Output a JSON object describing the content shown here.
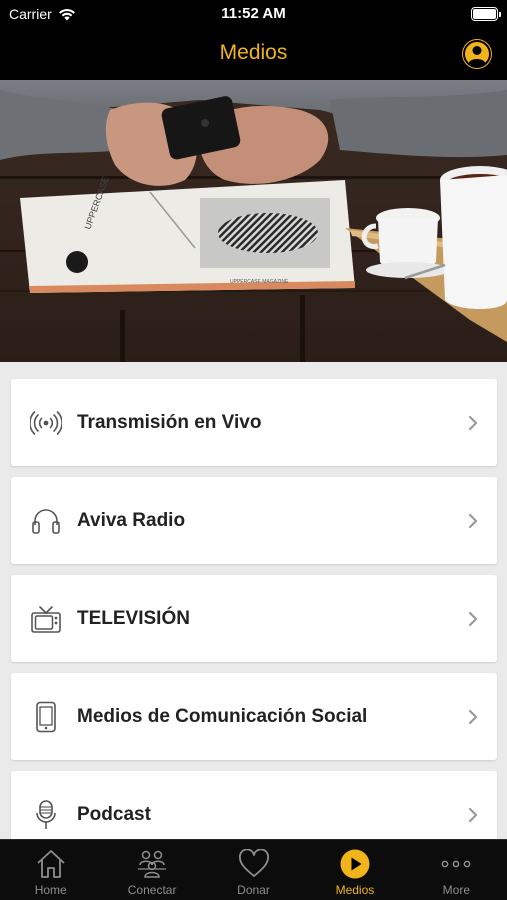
{
  "status_bar": {
    "carrier": "Carrier",
    "time": "11:52 AM",
    "battery_level": 1.0
  },
  "nav": {
    "title": "Medios",
    "profile_icon": "user-circle-icon"
  },
  "colors": {
    "accent": "#f2b41c",
    "background": "#000000",
    "list_background": "#eaeaea",
    "card": "#ffffff",
    "text": "#222222",
    "inactive": "#8e8e8e"
  },
  "hero": {
    "magazine_text": "UPPERCASE",
    "magazine_footer": "UPPERCASE MAGAZINE"
  },
  "menu": [
    {
      "label": "Transmisión en Vivo",
      "icon": "broadcast-icon"
    },
    {
      "label": "Aviva Radio",
      "icon": "headphones-icon"
    },
    {
      "label": "TELEVISIÓN",
      "icon": "tv-icon"
    },
    {
      "label": "Medios de Comunicación Social",
      "icon": "smartphone-icon"
    },
    {
      "label": "Podcast",
      "icon": "microphone-icon"
    }
  ],
  "tabs": [
    {
      "label": "Home",
      "icon": "home-icon",
      "active": false
    },
    {
      "label": "Conectar",
      "icon": "people-icon",
      "active": false
    },
    {
      "label": "Donar",
      "icon": "heart-icon",
      "active": false
    },
    {
      "label": "Medios",
      "icon": "play-icon",
      "active": true
    },
    {
      "label": "More",
      "icon": "more-icon",
      "active": false
    }
  ]
}
